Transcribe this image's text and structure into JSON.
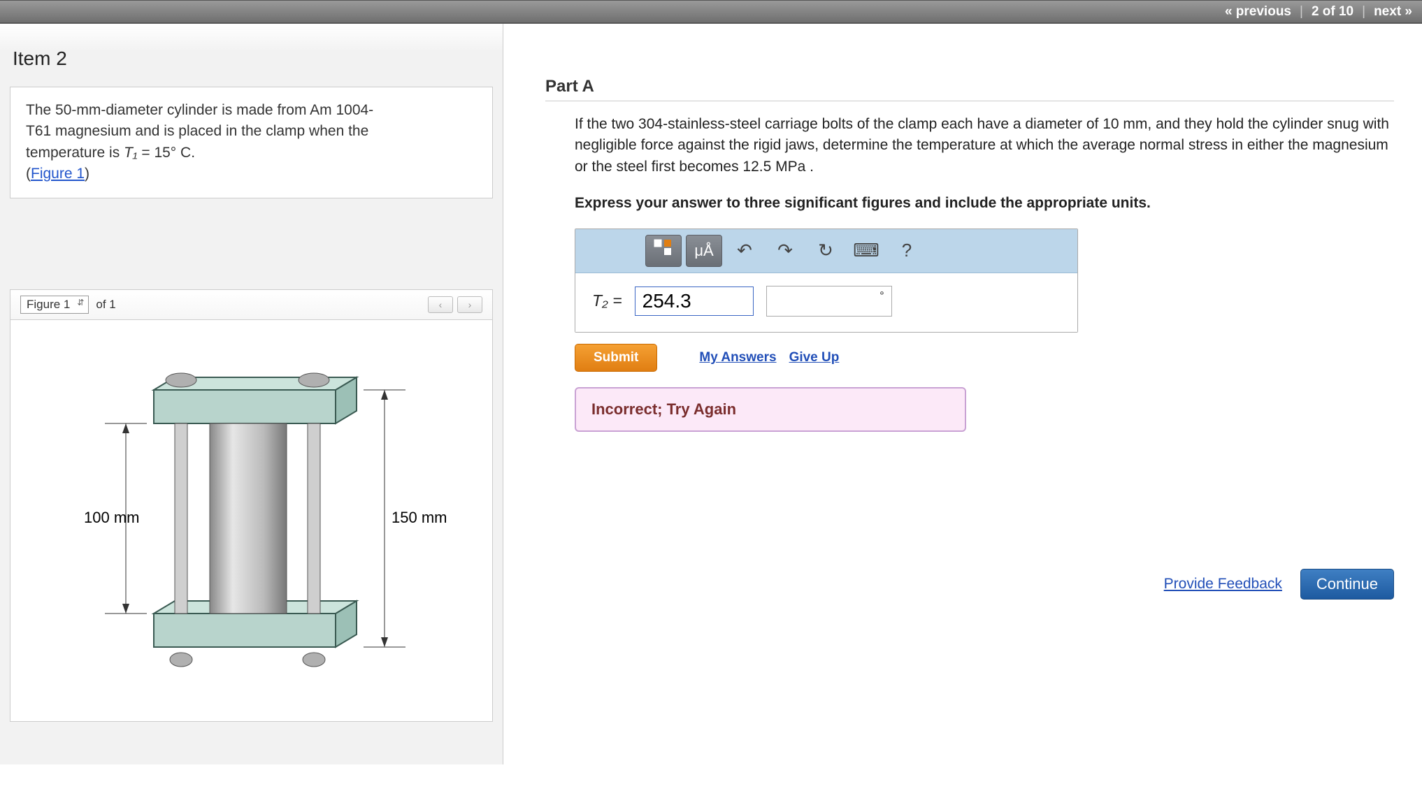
{
  "nav": {
    "prev": "« previous",
    "pos": "2 of 10",
    "next": "next »"
  },
  "item_title": "Item 2",
  "problem_html_parts": {
    "line1": "The 50-mm-diameter cylinder is made from Am 1004-",
    "line2": "T61 magnesium and is placed in the clamp when the",
    "line3a": "temperature is ",
    "line3var": "T₁",
    "line3b": " = 15° C.",
    "fig_link": "Figure 1"
  },
  "figure": {
    "selector_label": "Figure 1",
    "of_label": "of 1",
    "dim_left": "100 mm",
    "dim_right": "150 mm"
  },
  "part": {
    "title": "Part A",
    "text": "If the two 304-stainless-steel carriage bolts of the clamp each have a diameter of 10 mm, and they hold the cylinder snug with negligible force against the rigid jaws, determine the temperature at which the average normal stress in either the magnesium or the steel first becomes 12.5 MPa .",
    "instruction": "Express your answer to three significant figures and include the appropriate units."
  },
  "toolbar": {
    "templates": "▯▯",
    "greek": "μÅ",
    "undo": "↶",
    "redo": "↷",
    "reset": "↻",
    "keyboard": "⌨",
    "help": "?"
  },
  "answer": {
    "var_label": "T₂ =",
    "value": "254.3",
    "unit_degree": "°"
  },
  "actions": {
    "submit": "Submit",
    "my_answers": "My Answers",
    "give_up": "Give Up"
  },
  "feedback": "Incorrect; Try Again",
  "footer": {
    "provide": "Provide Feedback",
    "continue": "Continue"
  }
}
